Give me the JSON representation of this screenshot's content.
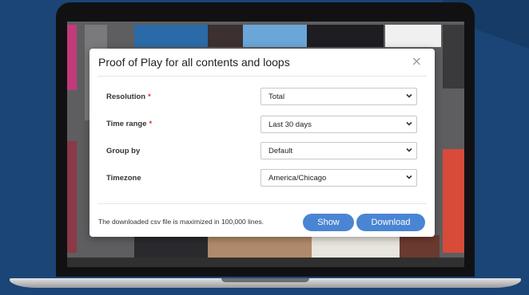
{
  "modal": {
    "title": "Proof of Play for all contents and loops",
    "close_glyph": "×",
    "required_mark": "*",
    "fields": [
      {
        "label": "Resolution",
        "required": true,
        "value": "Total"
      },
      {
        "label": "Time range",
        "required": true,
        "value": "Last 30 days"
      },
      {
        "label": "Group by",
        "required": false,
        "value": "Default"
      },
      {
        "label": "Timezone",
        "required": false,
        "value": "America/Chicago"
      }
    ],
    "footnote": "The downloaded csv file is maximized in 100,000 lines.",
    "show_label": "Show",
    "download_label": "Download"
  },
  "colors": {
    "background": "#1a4576",
    "primary_button": "#4a85d3",
    "required": "#e0352b"
  },
  "icons": [
    "close-icon",
    "chevron-down-icon"
  ]
}
